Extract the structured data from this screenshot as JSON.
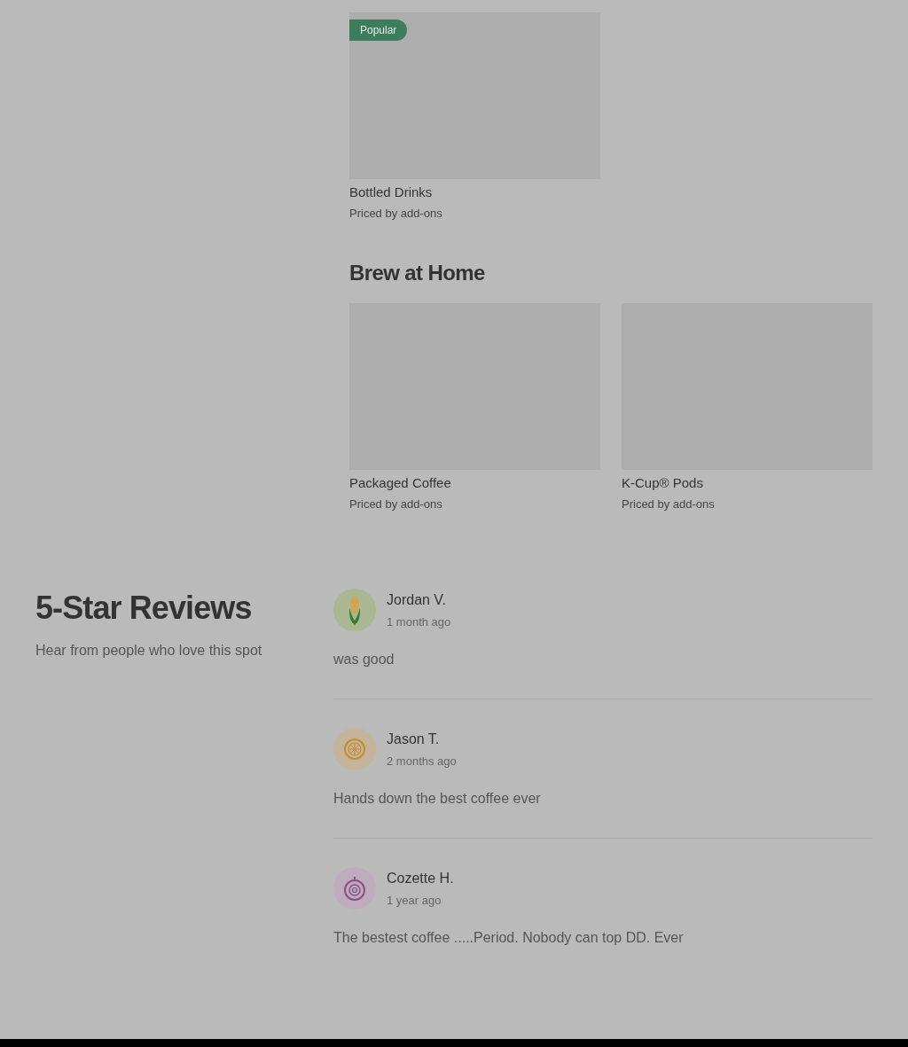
{
  "top_items": [
    {
      "badge": "Popular",
      "name": "Bottled Drinks",
      "price": "Priced by add-ons"
    }
  ],
  "section": {
    "title": "Brew at Home",
    "items": [
      {
        "name": "Packaged Coffee",
        "price": "Priced by add-ons"
      },
      {
        "name": "K-Cup® Pods",
        "price": "Priced by add-ons"
      }
    ]
  },
  "reviews_header": {
    "title": "5-Star Reviews",
    "subtitle": "Hear from people who love this spot"
  },
  "reviews": [
    {
      "name": "Jordan V.",
      "time": "1 month ago",
      "text": "was good",
      "avatar": {
        "kind": "corn",
        "color": "#a9b890"
      }
    },
    {
      "name": "Jason T.",
      "time": "2 months ago",
      "text": "Hands down the best coffee ever",
      "avatar": {
        "kind": "citrus",
        "color": "#c4b49a"
      }
    },
    {
      "name": "Cozette H.",
      "time": "1 year ago",
      "text": "The bestest coffee .....Period. Nobody can top DD. Ever",
      "avatar": {
        "kind": "onion",
        "color": "#bfadbf"
      }
    }
  ]
}
